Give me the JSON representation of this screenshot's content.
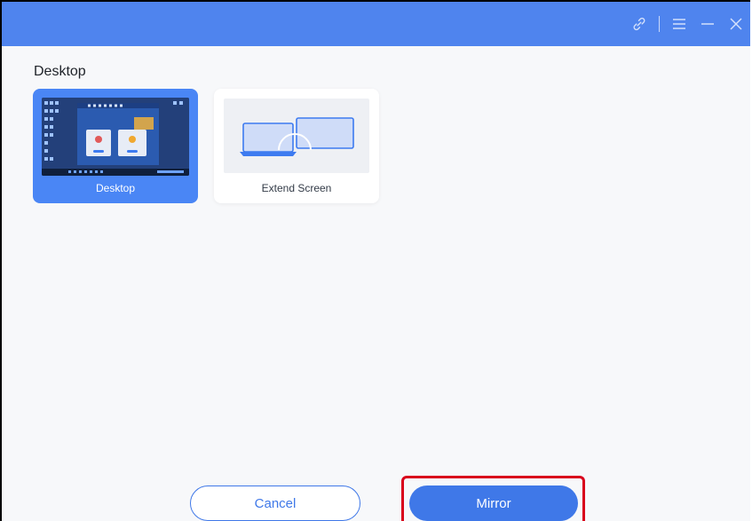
{
  "window": {
    "title": "",
    "accent_color": "#4f84ee",
    "controls": [
      {
        "name": "link-icon"
      },
      {
        "name": "menu-icon"
      },
      {
        "name": "minimize-icon"
      },
      {
        "name": "close-icon"
      }
    ]
  },
  "section": {
    "title": "Desktop"
  },
  "options": [
    {
      "label": "Desktop",
      "selected": true,
      "icon": "desktop-thumbnail"
    },
    {
      "label": "Extend Screen",
      "selected": false,
      "icon": "extend-screen-icon"
    }
  ],
  "actions": {
    "cancel_label": "Cancel",
    "mirror_label": "Mirror"
  },
  "highlight_color": "#d9001b"
}
